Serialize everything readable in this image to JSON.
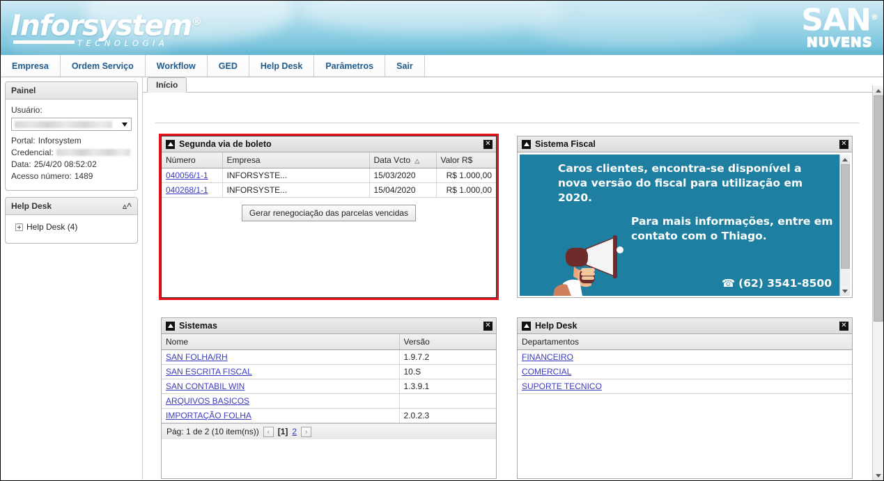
{
  "header": {
    "logo_main": "Inforsystem",
    "logo_trademark": "®",
    "logo_sub": "TECNOLOGIA",
    "brand_right_main": "SAN",
    "brand_right_trademark": "®",
    "brand_right_sub": "NUVENS",
    "accent_blue": "#7ec6de"
  },
  "nav": {
    "items": [
      {
        "label": "Empresa"
      },
      {
        "label": "Ordem Serviço"
      },
      {
        "label": "Workflow"
      },
      {
        "label": "GED"
      },
      {
        "label": "Help Desk"
      },
      {
        "label": "Parâmetros"
      },
      {
        "label": "Sair"
      }
    ]
  },
  "sidebar": {
    "panel": {
      "title": "Painel",
      "user_label": "Usuário:",
      "user_value": "",
      "portal_label": "Portal:",
      "portal_value": "Inforsystem",
      "credencial_label": "Credencial:",
      "credencial_value": "",
      "data_label": "Data:",
      "data_value": "25/4/20 08:52:02",
      "acesso_label": "Acesso número:",
      "acesso_value": "1489"
    },
    "helpdesk": {
      "title": "Help Desk",
      "collapse_icon": "chevron-up",
      "tree_item": "Help Desk (4)"
    }
  },
  "main": {
    "tab": {
      "label": "Início"
    }
  },
  "widgets": {
    "boleto": {
      "title": "Segunda via de boleto",
      "highlighted": true,
      "highlight_color": "#e8131a",
      "columns": [
        "Número",
        "Empresa",
        "Data Vcto",
        "Valor R$"
      ],
      "sort_column": "Data Vcto",
      "sort_indicator": "△",
      "rows": [
        {
          "numero": "040056/1-1",
          "empresa": "INFORSYSTE...",
          "vcto": "15/03/2020",
          "valor": "R$ 1.000,00"
        },
        {
          "numero": "040268/1-1",
          "empresa": "INFORSYSTE...",
          "vcto": "15/04/2020",
          "valor": "R$ 1.000,00"
        }
      ],
      "button_label": "Gerar renegociação das parcelas vencidas"
    },
    "sistema_fiscal": {
      "title": "Sistema Fiscal",
      "banner_color": "#1e7fa0",
      "text_line_1": "Caros clientes, encontra-se disponível a nova versão do fiscal para utilização em 2020.",
      "text_line_2": "Para mais informações, entre em contato com o Thiago.",
      "phone": "(62) 3541-8500",
      "phone_icon": "phone-icon"
    },
    "sistemas": {
      "title": "Sistemas",
      "columns": [
        "Nome",
        "Versão"
      ],
      "rows": [
        {
          "nome": "SAN FOLHA/RH",
          "versao": "1.9.7.2"
        },
        {
          "nome": "SAN ESCRITA FISCAL",
          "versao": "10.S"
        },
        {
          "nome": "SAN CONTABIL WIN",
          "versao": "1.3.9.1"
        },
        {
          "nome": "ARQUIVOS BASICOS",
          "versao": ""
        },
        {
          "nome": "IMPORTAÇÃO FOLHA",
          "versao": "2.0.2.3"
        }
      ],
      "pager": {
        "text": "Pág: 1 de 2 (10 item(ns))",
        "prev": "‹",
        "current": "[1]",
        "page2": "2",
        "next": "›"
      }
    },
    "help_desk": {
      "title": "Help Desk",
      "columns": [
        "Departamentos"
      ],
      "rows": [
        {
          "nome": "FINANCEIRO"
        },
        {
          "nome": "COMERCIAL"
        },
        {
          "nome": "SUPORTE TECNICO"
        }
      ]
    }
  }
}
